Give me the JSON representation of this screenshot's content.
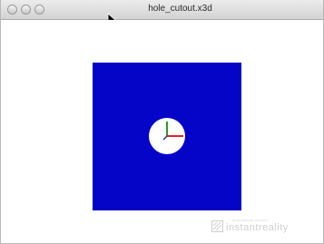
{
  "window": {
    "title": "hole_cutout.x3d"
  },
  "icons": {
    "traffic_lights": [
      "close-icon",
      "minimize-icon",
      "zoom-icon"
    ],
    "cursor": "arrow-cursor-icon",
    "axes": "axes-gizmo-icon",
    "logo": "instantreality-logo-icon"
  },
  "scene": {
    "plane_color": "#0505c8",
    "hole_color": "#ffffff",
    "axis_x_color": "#e02020",
    "axis_y_color": "#20a020"
  },
  "watermark": {
    "tagline": "dimensional service",
    "wordmark": "instantreality"
  }
}
